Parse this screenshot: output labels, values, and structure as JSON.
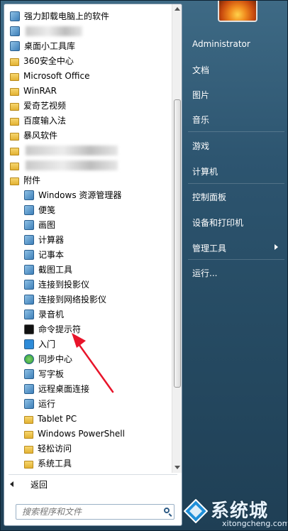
{
  "programs": [
    {
      "label": "强力卸载电脑上的软件",
      "icon": "uninstall-icon"
    },
    {
      "label": "",
      "icon": "blurred-item",
      "blurred": true
    },
    {
      "label": "桌面小工具库",
      "icon": "gadgets-icon"
    },
    {
      "label": "360安全中心",
      "icon": "folder-icon"
    },
    {
      "label": "Microsoft Office",
      "icon": "folder-icon"
    },
    {
      "label": "WinRAR",
      "icon": "folder-icon"
    },
    {
      "label": "爱奇艺视频",
      "icon": "folder-icon"
    },
    {
      "label": "百度输入法",
      "icon": "folder-icon"
    },
    {
      "label": "暴风软件",
      "icon": "folder-icon"
    },
    {
      "label": "",
      "icon": "folder-icon",
      "blurred": true
    },
    {
      "label": "",
      "icon": "folder-icon",
      "blurred": true
    },
    {
      "label": "附件",
      "icon": "folder-open-icon"
    },
    {
      "label": "Windows 资源管理器",
      "icon": "explorer-icon",
      "indent": true
    },
    {
      "label": "便笺",
      "icon": "sticky-notes-icon",
      "indent": true
    },
    {
      "label": "画图",
      "icon": "paint-icon",
      "indent": true
    },
    {
      "label": "计算器",
      "icon": "calculator-icon",
      "indent": true
    },
    {
      "label": "记事本",
      "icon": "notepad-icon",
      "indent": true
    },
    {
      "label": "截图工具",
      "icon": "snipping-tool-icon",
      "indent": true
    },
    {
      "label": "连接到投影仪",
      "icon": "projector-icon",
      "indent": true
    },
    {
      "label": "连接到网络投影仪",
      "icon": "network-projector-icon",
      "indent": true
    },
    {
      "label": "录音机",
      "icon": "microphone-icon",
      "indent": true
    },
    {
      "label": "命令提示符",
      "icon": "command-prompt-icon",
      "indent": true
    },
    {
      "label": "入门",
      "icon": "getting-started-icon",
      "indent": true
    },
    {
      "label": "同步中心",
      "icon": "sync-center-icon",
      "indent": true
    },
    {
      "label": "写字板",
      "icon": "wordpad-icon",
      "indent": true
    },
    {
      "label": "远程桌面连接",
      "icon": "remote-desktop-icon",
      "indent": true
    },
    {
      "label": "运行",
      "icon": "run-icon",
      "indent": true
    },
    {
      "label": "Tablet PC",
      "icon": "folder-icon",
      "indent": true
    },
    {
      "label": "Windows PowerShell",
      "icon": "folder-icon",
      "indent": true
    },
    {
      "label": "轻松访问",
      "icon": "folder-icon",
      "indent": true
    },
    {
      "label": "系统工具",
      "icon": "folder-icon",
      "indent": true
    }
  ],
  "back_label": "返回",
  "search": {
    "placeholder": "搜索程序和文件"
  },
  "right": {
    "user": "Administrator",
    "items": [
      "文档",
      "图片",
      "音乐",
      "游戏",
      "计算机",
      "控制面板",
      "设备和打印机",
      "管理工具",
      "运行..."
    ]
  },
  "watermark": {
    "text": "系统城",
    "url": "xitongcheng.com"
  },
  "colors": {
    "panel_bg": "#2d5570",
    "accent_arrow": "#e8142a",
    "folder": "#e3b233"
  }
}
